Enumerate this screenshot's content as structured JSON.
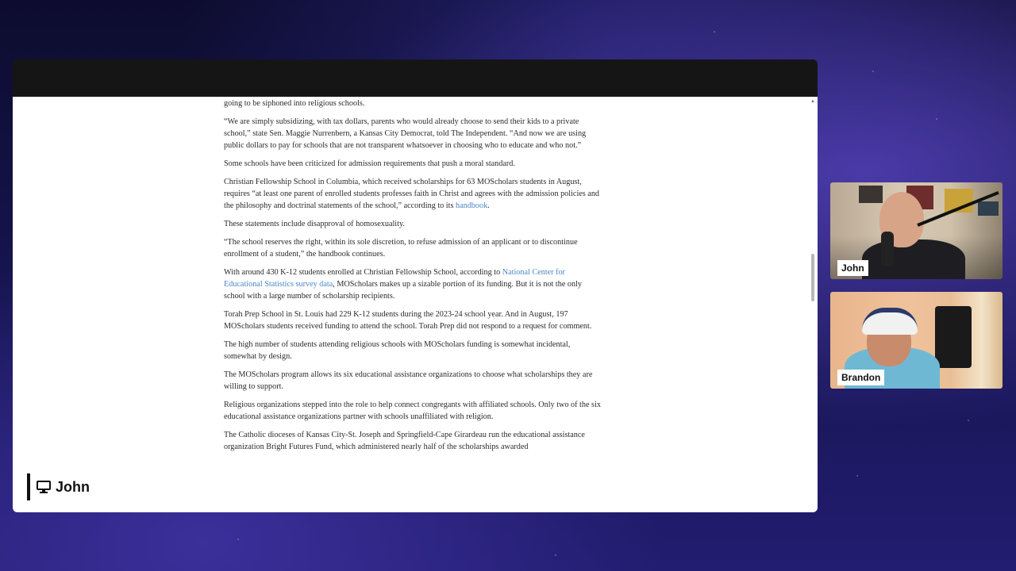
{
  "article": {
    "paragraphs": [
      {
        "parts": [
          {
            "text": "going to be siphoned into religious schools."
          }
        ]
      },
      {
        "parts": [
          {
            "text": "“We are simply subsidizing, with tax dollars, parents who would already choose to send their kids to a private school,” state Sen. Maggie Nurrenbern, a Kansas City Democrat, told The Independent. “And now we are using public dollars to pay for schools that are not transparent whatsoever in choosing who to educate and who not.”"
          }
        ]
      },
      {
        "parts": [
          {
            "text": "Some schools have been criticized for admission requirements that push a moral standard."
          }
        ]
      },
      {
        "parts": [
          {
            "text": "Christian Fellowship School in Columbia, which received scholarships for 63 MOScholars students in August, requires “at least one parent of enrolled students professes faith in Christ and agrees with the admission policies and the philosophy and doctrinal statements of the school,” according to its "
          },
          {
            "text": "handbook",
            "link": true
          },
          {
            "text": "."
          }
        ]
      },
      {
        "parts": [
          {
            "text": "These statements include disapproval of homosexuality."
          }
        ]
      },
      {
        "parts": [
          {
            "text": "“The school reserves the right, within its sole discretion, to refuse admission of an applicant or to discontinue enrollment of a student,” the handbook continues."
          }
        ]
      },
      {
        "parts": [
          {
            "text": "With around 430 K-12 students enrolled at Christian Fellowship School, according to "
          },
          {
            "text": "National Center for Educational Statistics survey data",
            "link": true
          },
          {
            "text": ", MOScholars makes up a sizable portion of its funding. But it is not the only school with a large number of scholarship recipients."
          }
        ]
      },
      {
        "parts": [
          {
            "text": "Torah Prep School in St. Louis had 229 K-12 students during the 2023-24 school year. And in August, 197 MOScholars students received funding to attend the school. Torah Prep did not respond to a request for comment."
          }
        ]
      },
      {
        "parts": [
          {
            "text": "The high number of students attending religious schools with MOScholars funding is somewhat incidental, somewhat by design."
          }
        ]
      },
      {
        "parts": [
          {
            "text": "The MOScholars program allows its six educational assistance organizations to choose what scholarships they are willing to support."
          }
        ]
      },
      {
        "parts": [
          {
            "text": "Religious organizations stepped into the role to help connect congregants with affiliated schools. Only two of the six educational assistance organizations partner with schools unaffiliated with religion."
          }
        ]
      },
      {
        "parts": [
          {
            "text": "The Catholic dioceses of Kansas City-St. Joseph and Springfield-Cape Girardeau run the educational assistance organization Bright Futures Fund, which administered nearly half of the scholarships awarded"
          }
        ]
      }
    ]
  },
  "presenter": {
    "icon": "monitor-icon",
    "name": "John"
  },
  "participants": [
    {
      "name": "John"
    },
    {
      "name": "Brandon"
    }
  ],
  "colors": {
    "link": "#4a86c5",
    "frame": "#151515"
  }
}
